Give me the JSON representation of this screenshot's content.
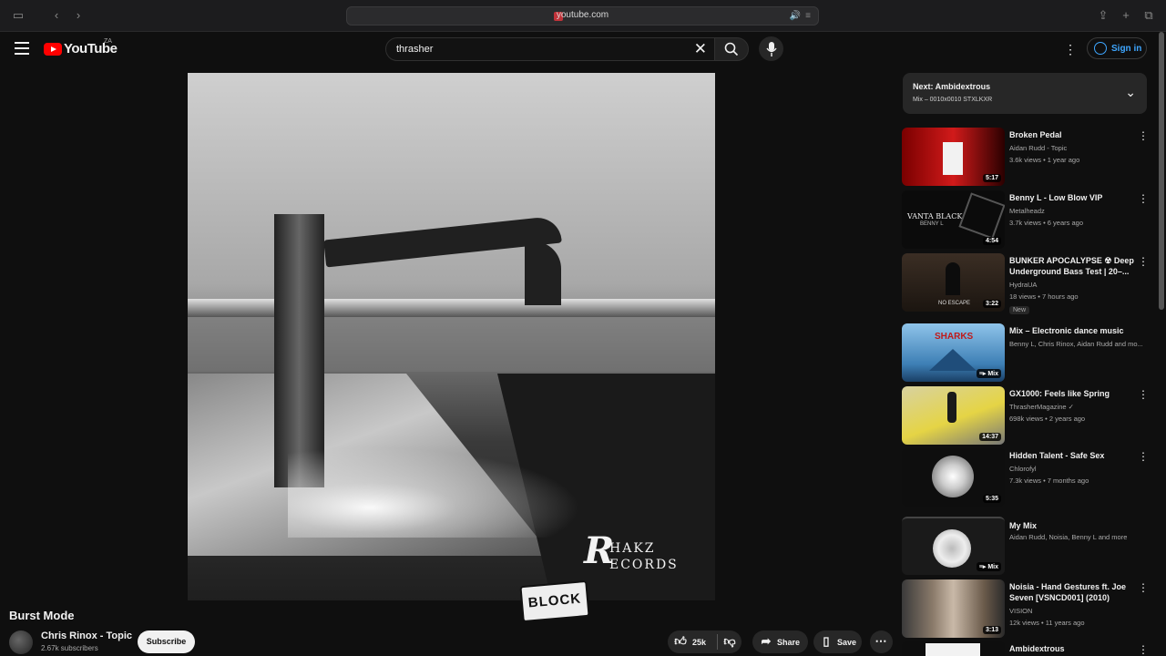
{
  "browser": {
    "url": "youtube.com"
  },
  "header": {
    "logo_text": "YouTube",
    "country": "ZA",
    "search_value": "thrasher",
    "signin_label": "Sign in"
  },
  "artwork": {
    "logo_letter": "R",
    "logo_line1": "HAKZ",
    "logo_line2": "ECORDS",
    "stamp": "BLOCK"
  },
  "video": {
    "title": "Burst Mode",
    "channel": "Chris Rinox - Topic",
    "subscribers": "2.67k subscribers",
    "subscribe_label": "Subscribe",
    "likes": "25k",
    "share_label": "Share",
    "save_label": "Save"
  },
  "next": {
    "title": "Next: Ambidextrous",
    "subtitle": "Mix – 0010x0010 STXLKXR"
  },
  "recommendations": [
    {
      "title": "Broken Pedal",
      "channel": "Aidan Rudd - Topic",
      "meta": "3.6k views • 1 year ago",
      "duration": "5:17"
    },
    {
      "title": "Benny L - Low Blow VIP",
      "channel": "Metalheadz",
      "meta": "3.7k views • 6 years ago",
      "duration": "4:54",
      "thumb_text": "VANTA BLACK",
      "thumb_sub": "BENNY L"
    },
    {
      "title": "BUNKER APOCALYPSE ☢ Deep Underground Bass Test | 20–...",
      "channel": "HydraUA",
      "meta": "18 views • 7 hours ago",
      "duration": "3:22",
      "badge": "New",
      "thumb_text": "NO ESCAPE"
    },
    {
      "title": "Mix – Electronic dance music",
      "channel": "Benny L, Chris Rinox, Aidan Rudd and mo...",
      "meta": "",
      "duration": "Mix",
      "thumb_text": "SHARKS"
    },
    {
      "title": "GX1000: Feels like Spring",
      "channel": "ThrasherMagazine ✓",
      "meta": "698k views • 2 years ago",
      "duration": "14:37"
    },
    {
      "title": "Hidden Talent - Safe Sex",
      "channel": "Chlorofyl",
      "meta": "7.3k views • 7 months ago",
      "duration": "5:35"
    },
    {
      "title": "My Mix",
      "channel": "Aidan Rudd, Noisia, Benny L and more",
      "meta": "",
      "duration": "Mix"
    },
    {
      "title": "Noisia - Hand Gestures ft. Joe Seven [VSNCD001] (2010)",
      "channel": "VISION",
      "meta": "12k views • 11 years ago",
      "duration": "3:13"
    },
    {
      "title": "Ambidextrous",
      "channel": "",
      "meta": "",
      "duration": ""
    }
  ]
}
